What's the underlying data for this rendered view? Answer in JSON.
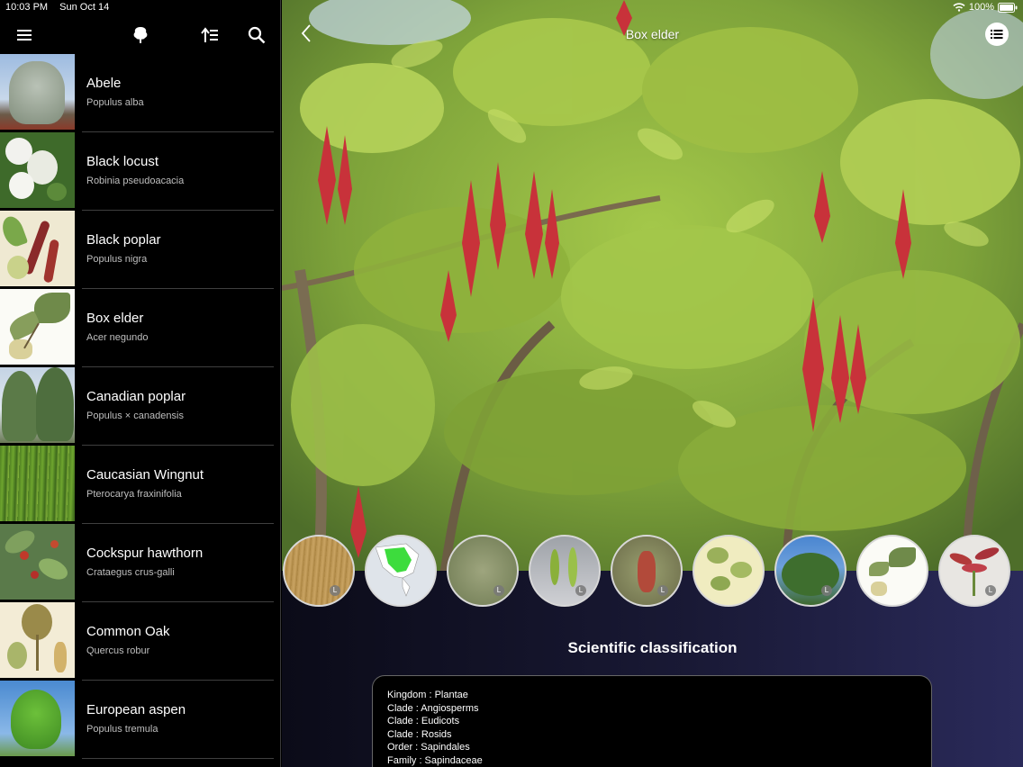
{
  "status_bar": {
    "time": "10:03 PM",
    "date": "Sun Oct 14",
    "battery": "100%"
  },
  "toolbar": {
    "menu_icon": "menu-icon",
    "tree_icon": "tree-icon",
    "sort_icon": "sort-icon",
    "search_icon": "search-icon"
  },
  "tree_list": [
    {
      "name": "Abele",
      "scientific": "Populus alba"
    },
    {
      "name": "Black locust",
      "scientific": "Robinia pseudoacacia"
    },
    {
      "name": "Black poplar",
      "scientific": "Populus nigra"
    },
    {
      "name": "Box elder",
      "scientific": "Acer negundo"
    },
    {
      "name": "Canadian poplar",
      "scientific": "Populus × canadensis"
    },
    {
      "name": "Caucasian Wingnut",
      "scientific": "Pterocarya fraxinifolia"
    },
    {
      "name": "Cockspur hawthorn",
      "scientific": "Crataegus crus-galli"
    },
    {
      "name": "Common Oak",
      "scientific": "Quercus robur"
    },
    {
      "name": "European aspen",
      "scientific": "Populus tremula"
    }
  ],
  "detail": {
    "title": "Box elder",
    "back_icon": "chevron-left-icon",
    "list_icon": "list-icon",
    "gallery_badges": [
      "L",
      "",
      "L",
      "L",
      "L",
      "",
      "L",
      "",
      "L"
    ],
    "section_title": "Scientific classification",
    "classification": [
      "Kingdom : Plantae",
      "Clade : Angiosperms",
      "Clade : Eudicots",
      "Clade : Rosids",
      "Order : Sapindales",
      "Family : Sapindaceae"
    ]
  }
}
